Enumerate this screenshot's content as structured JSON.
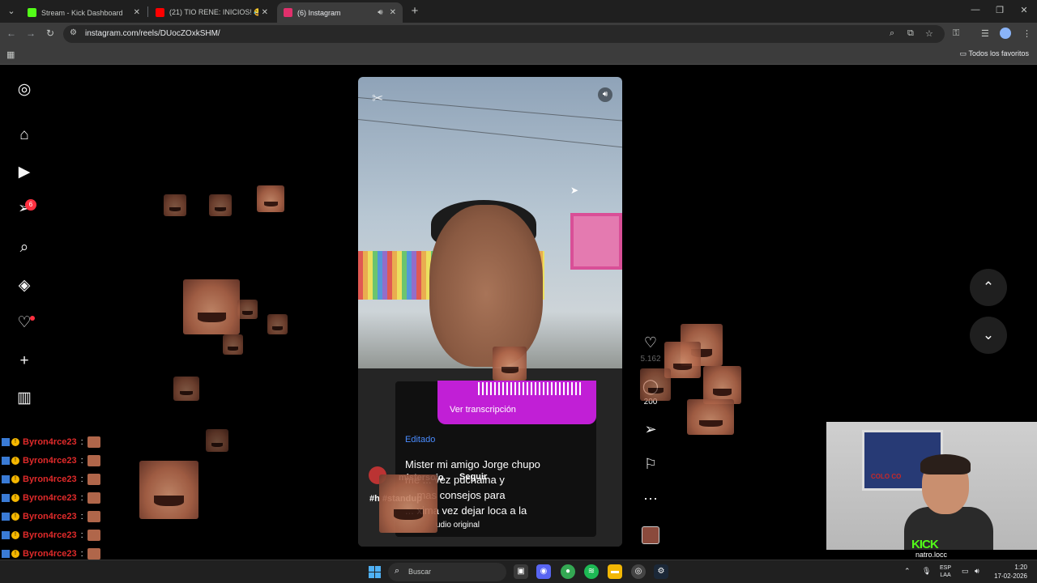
{
  "browser": {
    "tabs": [
      {
        "title": "Stream - Kick Dashboard",
        "favicon_color": "#53fc18",
        "active": false
      },
      {
        "title": "(21) TIO RENE: INICIOS! 😂😂",
        "favicon_color": "#ff0000",
        "active": false
      },
      {
        "title": "(6) Instagram",
        "favicon_color": "#e1306c",
        "active": true
      }
    ],
    "url": "instagram.com/reels/DUocZOxkSHM/",
    "bookmarks_all": "Todos los favoritos"
  },
  "instagram": {
    "sidebar": [
      {
        "name": "instagram-logo-icon",
        "glyph": "◎"
      },
      {
        "name": "home-icon",
        "glyph": "⌂"
      },
      {
        "name": "reels-icon",
        "glyph": "▶"
      },
      {
        "name": "messages-icon",
        "glyph": "➢"
      },
      {
        "name": "search-icon",
        "glyph": "⌕"
      },
      {
        "name": "explore-icon",
        "glyph": "◈"
      },
      {
        "name": "notifications-icon",
        "glyph": "♡"
      },
      {
        "name": "create-icon",
        "glyph": "+"
      },
      {
        "name": "dashboard-icon",
        "glyph": "▥"
      }
    ],
    "messages_badge": "6",
    "reel": {
      "transcript_button": "Ver transcripción",
      "edited_label": "Editado",
      "caption": "Mister mi amigo Jorge chupo ... vez puchaina y ... mas consejos para la proxima vez dejar loca a la",
      "caption_lines": [
        "Mister mi amigo Jorge chupo",
        "me ... vez puchaina y",
        "... mas consejos para",
        "... xima vez dejar loca a la"
      ],
      "username": "mistersoio",
      "follow_label": "Seguir",
      "hashtags": "#h    #standup",
      "audio": "udio original"
    },
    "actions": {
      "likes": "5.162",
      "comments": "200"
    }
  },
  "stream": {
    "chat": [
      {
        "user": "Byron4rce23"
      },
      {
        "user": "Byron4rce23"
      },
      {
        "user": "Byron4rce23"
      },
      {
        "user": "Byron4rce23"
      },
      {
        "user": "Byron4rce23"
      },
      {
        "user": "Byron4rce23"
      },
      {
        "user": "Byron4rce23"
      }
    ],
    "webcam_poster": "COLO CO",
    "kick_logo": "KICK",
    "kick_user": "natro.locc"
  },
  "taskbar": {
    "search_placeholder": "Buscar",
    "lang_top": "ESP",
    "lang_bottom": "LAA",
    "time": "1:20",
    "date": "17-02-2026"
  }
}
